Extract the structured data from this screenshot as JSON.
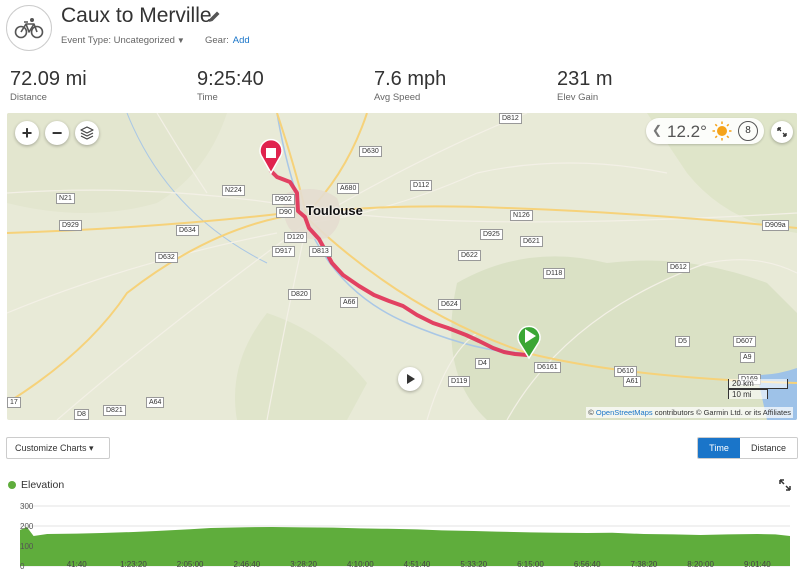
{
  "activity": {
    "title": "Caux to Merville",
    "event_type": "Event Type: Uncategorized",
    "gear_label": "Gear:",
    "gear_add": "Add"
  },
  "stats": [
    {
      "value": "72.09 mi",
      "label": "Distance"
    },
    {
      "value": "9:25:40",
      "label": "Time"
    },
    {
      "value": "7.6 mph",
      "label": "Avg Speed"
    },
    {
      "value": "231 m",
      "label": "Elev Gain"
    }
  ],
  "map": {
    "zoom_in": "+",
    "zoom_out": "−",
    "city": "Toulouse",
    "weather": {
      "temp": "12.2°",
      "wind": "8",
      "icon": "sun-icon"
    },
    "scale_km": "20 km",
    "scale_mi": "10 mi",
    "attribution_prefix": "©",
    "attribution_link": "OpenStreetMaps",
    "attribution_rest": "contributors © Garmin Ltd. or its Affiliates",
    "route_color": "#e0234e",
    "start_color": "#3aa635",
    "end_color": "#e0234e",
    "road_labels": [
      "D812",
      "D630",
      "N224",
      "A680",
      "D112",
      "N21",
      "D902",
      "D90",
      "D929",
      "D634",
      "D120",
      "N126",
      "D909a",
      "D925",
      "D621",
      "D632",
      "D917",
      "D813",
      "D622",
      "D118",
      "D612",
      "D820",
      "A66",
      "D624",
      "D607",
      "D5",
      "A9",
      "D4",
      "D6161",
      "D610",
      "A61",
      "D169",
      "D119",
      "D821",
      "A64",
      "D8",
      "17"
    ]
  },
  "controls": {
    "customize_charts": "Customize Charts ▾",
    "time": "Time",
    "distance": "Distance"
  },
  "elevation": {
    "title": "Elevation",
    "color": "#5fad3c"
  },
  "chart_data": {
    "type": "area",
    "title": "Elevation",
    "xlabel": "",
    "ylabel": "",
    "ylim": [
      0,
      300
    ],
    "y_ticks": [
      "300",
      "200",
      "100",
      "0"
    ],
    "x_ticks": [
      "41:40",
      "1:23:20",
      "2:05:00",
      "2:46:40",
      "3:28:20",
      "4:10:00",
      "4:51:40",
      "5:33:20",
      "6:15:00",
      "6:56:40",
      "7:38:20",
      "8:20:00",
      "9:01:40"
    ],
    "series": [
      {
        "x_minutes": [
          0,
          5,
          10,
          20,
          41.7,
          60,
          83.3,
          100,
          125,
          140,
          166.7,
          185,
          208.3,
          230,
          250,
          270,
          291.7,
          310,
          333.3,
          350,
          375,
          395,
          416.7,
          435,
          458.3,
          480,
          500,
          520,
          541.7,
          555,
          565.7
        ],
        "values": [
          180,
          195,
          150,
          160,
          162,
          165,
          170,
          175,
          184,
          190,
          194,
          195,
          193,
          192,
          188,
          186,
          183,
          178,
          175,
          172,
          168,
          166,
          165,
          166,
          160,
          158,
          155,
          158,
          160,
          158,
          150
        ]
      }
    ]
  }
}
